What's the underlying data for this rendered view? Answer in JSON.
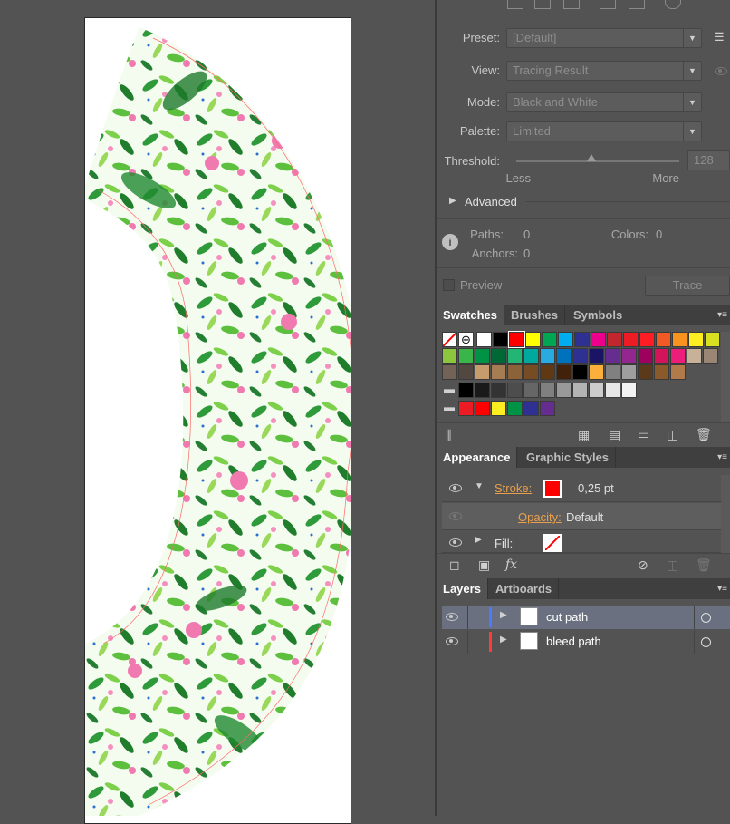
{
  "trace": {
    "preset_label": "Preset:",
    "preset_value": "[Default]",
    "view_label": "View:",
    "view_value": "Tracing Result",
    "mode_label": "Mode:",
    "mode_value": "Black and White",
    "palette_label": "Palette:",
    "palette_value": "Limited",
    "threshold_label": "Threshold:",
    "threshold_value": "128",
    "less_label": "Less",
    "more_label": "More",
    "advanced_label": "Advanced",
    "paths_label": "Paths:",
    "paths_value": "0",
    "colors_label": "Colors:",
    "colors_value": "0",
    "anchors_label": "Anchors:",
    "anchors_value": "0",
    "preview_label": "Preview",
    "trace_button": "Trace"
  },
  "swatches_panel": {
    "tabs": [
      "Swatches",
      "Brushes",
      "Symbols"
    ],
    "colors": {
      "row1": [
        "#ffffff",
        "#000000",
        "#ff0000",
        "#ffff00",
        "#00a651",
        "#00aeef",
        "#2e3192",
        "#ec008c",
        "#c1272d",
        "#ed1c24",
        "#ff1d25",
        "#f15a24",
        "#f7931e",
        "#fcee21",
        "#d9e021"
      ],
      "row2": [
        "#8cc63f",
        "#39b54a",
        "#009245",
        "#006837",
        "#22b573",
        "#00a99d",
        "#29abe2",
        "#0071bc",
        "#2e3192",
        "#1b1464",
        "#662d91",
        "#93278f",
        "#9e005d",
        "#d4145a",
        "#ed1e79",
        "#c7b299",
        "#998675"
      ],
      "row3": [
        "#736357",
        "#534741",
        "#c69c6d",
        "#a67c52",
        "#8c6239",
        "#754c24",
        "#603813",
        "#42210b",
        "#000000",
        "#fbb03b",
        "#808080",
        "#9e9e9e",
        "#5a3a1a",
        "#8a5a2a",
        "#b07a4a"
      ],
      "row4": [
        "#000000",
        "#1a1a1a",
        "#333333",
        "#4d4d4d",
        "#666666",
        "#808080",
        "#999999",
        "#b3b3b3",
        "#cccccc",
        "#e6e6e6",
        "#f2f2f2"
      ],
      "row5": [
        "#ed1c24",
        "#ff0000",
        "#fcee21",
        "#009245",
        "#2e3192",
        "#662d91"
      ]
    }
  },
  "appearance_panel": {
    "tabs": [
      "Appearance",
      "Graphic Styles"
    ],
    "stroke_label": "Stroke:",
    "stroke_value": "0,25 pt",
    "stroke_color": "#ff0000",
    "opacity_label": "Opacity:",
    "opacity_value": "Default",
    "fill_label": "Fill:"
  },
  "layers_panel": {
    "tabs": [
      "Layers",
      "Artboards"
    ],
    "layers": [
      {
        "name": "cut path",
        "color": "#4a7bff"
      },
      {
        "name": "bleed path",
        "color": "#ff3b3b"
      }
    ]
  }
}
